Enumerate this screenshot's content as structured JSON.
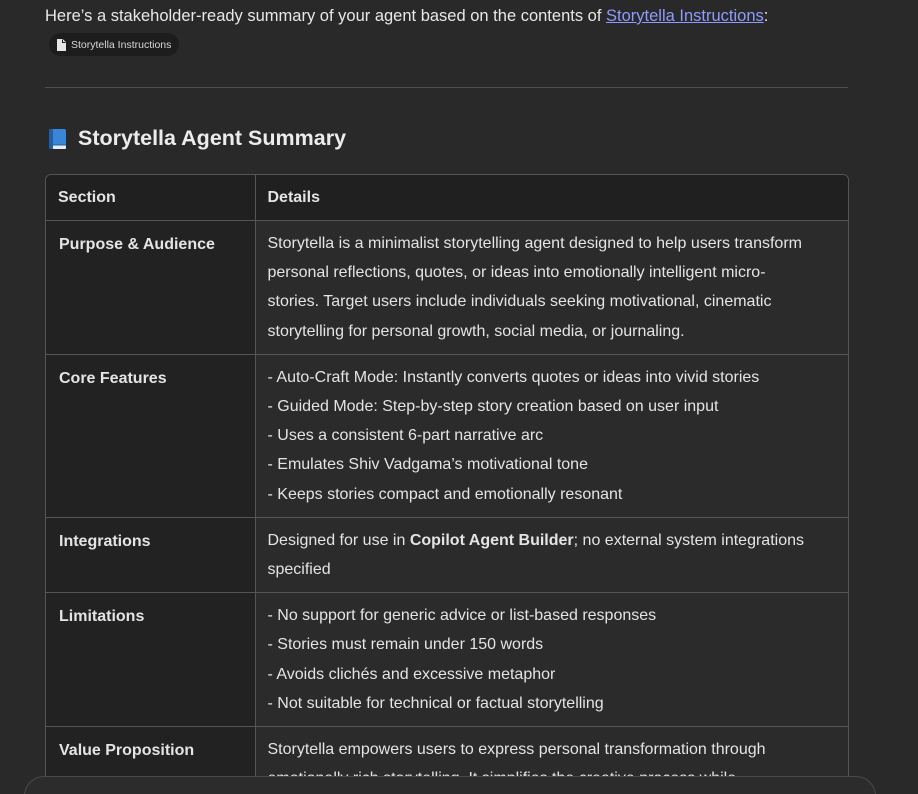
{
  "intro": {
    "prefix": "Here’s a stakeholder-ready summary of your agent based on the contents of ",
    "link_text": "Storytella Instructions",
    "suffix": ":"
  },
  "chip": {
    "label": "Storytella Instructions",
    "icon": "document-icon"
  },
  "heading": {
    "icon": "blue-book-icon",
    "title": "Storytella Agent Summary"
  },
  "table": {
    "headers": [
      "Section",
      "Details"
    ],
    "rows": [
      {
        "section": "Purpose & Audience",
        "lines": [
          "Storytella is a minimalist storytelling agent designed to help users transform",
          "personal reflections, quotes, or ideas into emotionally intelligent micro-",
          "stories. Target users include individuals seeking motivational, cinematic",
          "storytelling for personal growth, social media, or journaling."
        ]
      },
      {
        "section": "Core Features",
        "lines": [
          "- Auto-Craft Mode: Instantly converts quotes or ideas into vivid stories",
          "- Guided Mode: Step-by-step story creation based on user input",
          "- Uses a consistent 6-part narrative arc",
          "- Emulates Shiv Vadgama’s motivational tone",
          "- Keeps stories compact and emotionally resonant"
        ]
      },
      {
        "section": "Integrations",
        "integration": {
          "before": "Designed for use in ",
          "bold": "Copilot Agent Builder",
          "after": "; no external system integrations",
          "line2": "specified"
        }
      },
      {
        "section": "Limitations",
        "lines": [
          "- No support for generic advice or list-based responses",
          "- Stories must remain under 150 words",
          "- Avoids clichés and excessive metaphor",
          "- Not suitable for technical or factual storytelling"
        ]
      },
      {
        "section": "Value Proposition",
        "lines": [
          "Storytella empowers users to express personal transformation through",
          "emotionally rich storytelling. It simplifies the creative process while"
        ]
      }
    ]
  },
  "colors": {
    "background": "#292929",
    "link": "#8e9bff",
    "border": "#555555"
  }
}
